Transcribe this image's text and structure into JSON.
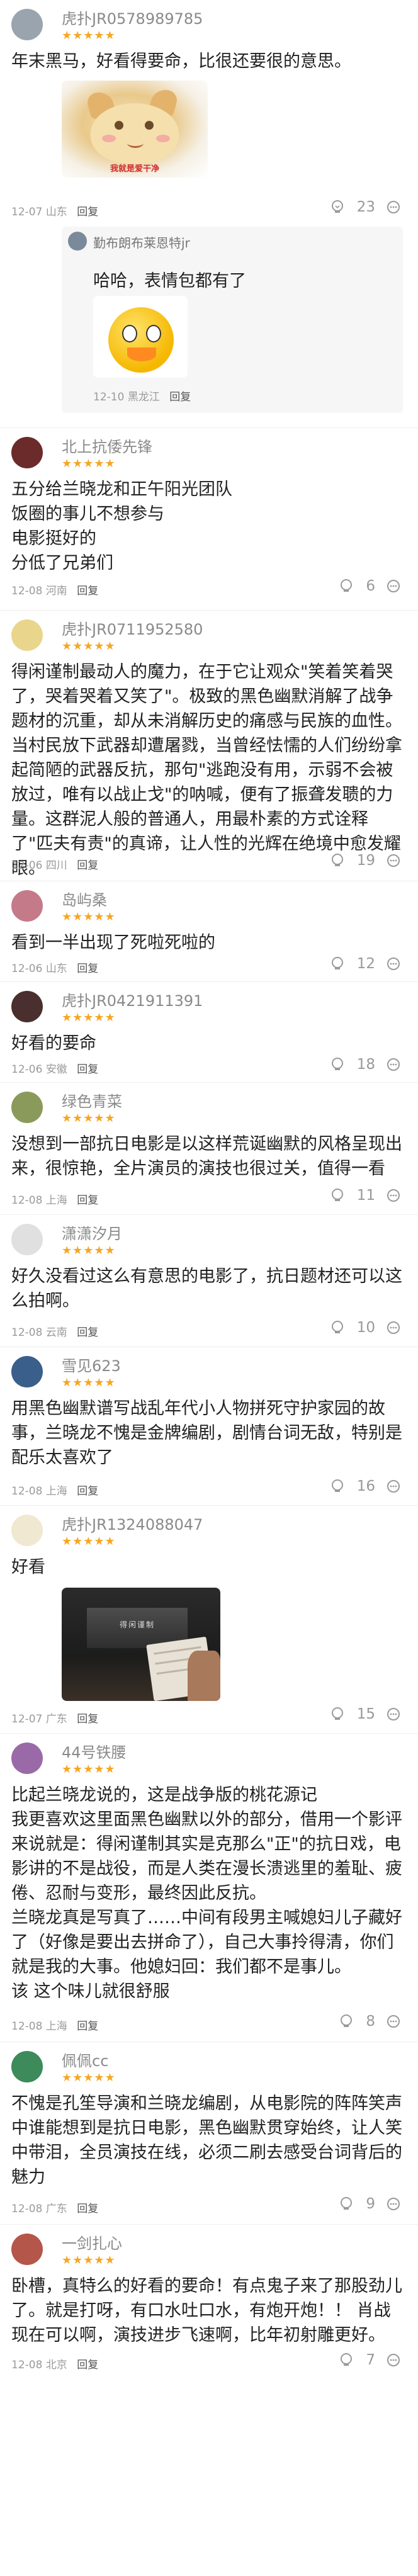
{
  "comments": [
    {
      "username": "虎扑JR0578989785",
      "text": "年末黑马，好看得要命，比很还要很的意思。",
      "sticker_caption": "我就是爱干净",
      "meta_date": "12-07",
      "meta_location": "山东",
      "reply_label": "回复",
      "likes": "23",
      "nested_reply": {
        "username": "勤布朗布莱恩特jr",
        "text": "哈哈，表情包都有了",
        "meta_date": "12-10",
        "meta_location": "黑龙江",
        "reply_label": "回复"
      }
    },
    {
      "username": "北上抗倭先锋",
      "text": "五分给兰晓龙和正午阳光团队\n饭圈的事儿不想参与\n电影挺好的\n分低了兄弟们",
      "meta_date": "12-08",
      "meta_location": "河南",
      "reply_label": "回复",
      "likes": "6"
    },
    {
      "username": "虎扑JR0711952580",
      "text": "得闲谨制最动人的魔力，在于它让观众\"笑着笑着哭了，哭着哭着又笑了\"。极致的黑色幽默消解了战争题材的沉重，却从未消解历史的痛感与民族的血性。当村民放下武器却遭屠戮，当曾经怯懦的人们纷纷拿起简陋的武器反抗，那句\"逃跑没有用，示弱不会被放过，唯有以战止戈\"的呐喊，便有了振聋发聩的力量。这群泥人般的普通人，用最朴素的方式诠释了\"匹夫有责\"的真谛，让人性的光辉在绝境中愈发耀眼。",
      "meta_date": "12-06",
      "meta_location": "四川",
      "reply_label": "回复",
      "likes": "19"
    },
    {
      "username": "岛屿桑",
      "text": "看到一半出现了死啦死啦的",
      "meta_date": "12-06",
      "meta_location": "山东",
      "reply_label": "回复",
      "likes": "12"
    },
    {
      "username": "虎扑JR0421911391",
      "text": "好看的要命",
      "meta_date": "12-06",
      "meta_location": "安徽",
      "reply_label": "回复",
      "likes": "18"
    },
    {
      "username": "绿色青菜",
      "text": "没想到一部抗日电影是以这样荒诞幽默的风格呈现出来，很惊艳，全片演员的演技也很过关，值得一看",
      "meta_date": "12-08",
      "meta_location": "上海",
      "reply_label": "回复",
      "likes": "11"
    },
    {
      "username": "潇潇汐月",
      "text": "好久没看过这么有意思的电影了，抗日题材还可以这么拍啊。",
      "meta_date": "12-08",
      "meta_location": "云南",
      "reply_label": "回复",
      "likes": "10"
    },
    {
      "username": "雪见623",
      "text": "用黑色幽默谱写战乱年代小人物拼死守护家园的故事，兰晓龙不愧是金牌编剧，剧情台词无敌，特别是配乐太喜欢了",
      "meta_date": "12-08",
      "meta_location": "上海",
      "reply_label": "回复",
      "likes": "16"
    },
    {
      "username": "虎扑JR1324088047",
      "text": "好看",
      "photo_title": "得闲谨制",
      "meta_date": "12-07",
      "meta_location": "广东",
      "reply_label": "回复",
      "likes": "15"
    },
    {
      "username": "44号铁腰",
      "text": "比起兰晓龙说的，这是战争版的桃花源记\n我更喜欢这里面黑色幽默以外的部分，借用一个影评来说就是：得闲谨制其实是克那么\"正\"的抗日戏，电影讲的不是战役，而是人类在漫长溃逃里的羞耻、疲倦、忍耐与变形，最终因此反抗。\n兰晓龙真是写真了……中间有段男主喊媳妇儿子藏好了（好像是要出去拼命了），自己大事拎得清，你们就是我的大事。他媳妇回：我们都不是事儿。\n该 这个味儿就很舒服",
      "meta_date": "12-08",
      "meta_location": "上海",
      "reply_label": "回复",
      "likes": "8"
    },
    {
      "username": "佩佩cc",
      "text": "不愧是孔笙导演和兰晓龙编剧，从电影院的阵阵笑声中谁能想到是抗日电影，黑色幽默贯穿始终，让人笑中带泪，全员演技在线，必须二刷去感受台词背后的魅力",
      "meta_date": "12-08",
      "meta_location": "广东",
      "reply_label": "回复",
      "likes": "9"
    },
    {
      "username": "一剑扎心",
      "text": "卧槽，真特么的好看的要命！有点鬼子来了那股劲儿了。就是打呀，有口水吐口水，有炮开炮！！ 肖战现在可以啊，演技进步飞速啊，比年初射雕更好。",
      "meta_date": "12-08",
      "meta_location": "北京",
      "reply_label": "回复",
      "likes": "7"
    }
  ],
  "icons": {
    "like": "lightbulb-like-icon",
    "more": "more-dots-icon",
    "avatar": "user-avatar"
  },
  "colors": {
    "star": "#f6a623",
    "meta": "#9a9a9a"
  }
}
